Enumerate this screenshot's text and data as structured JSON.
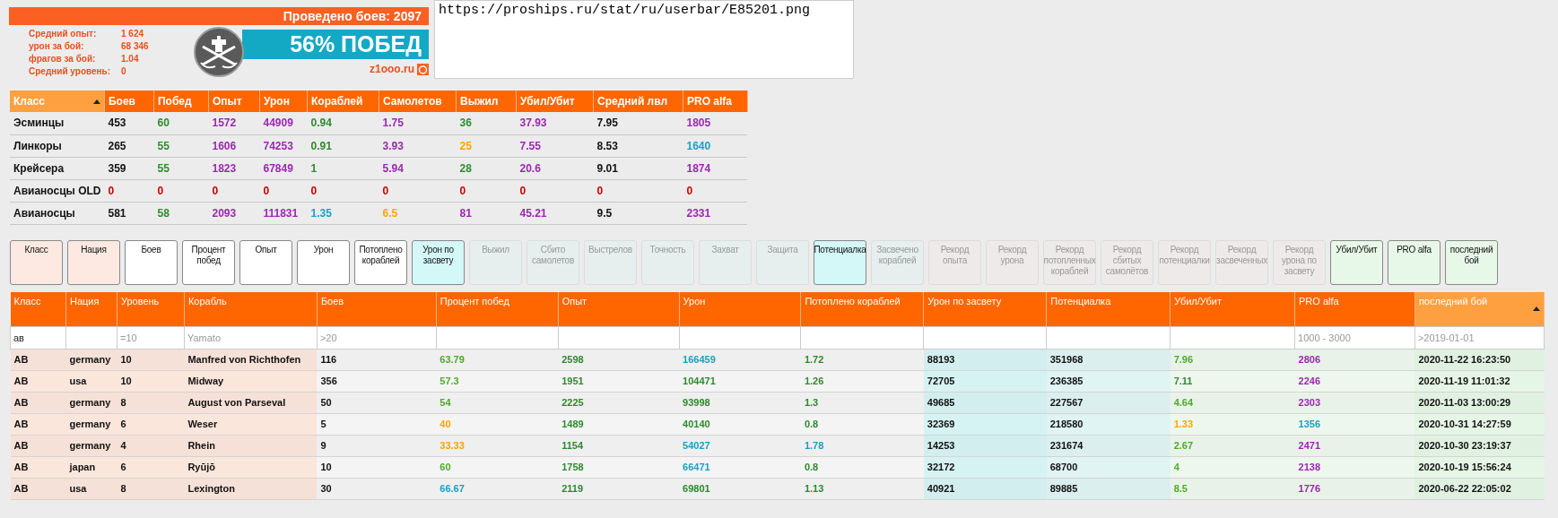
{
  "userbar": {
    "battles": "Проведено боев: 2097",
    "stats": [
      {
        "label": "Средний опыт:",
        "value": "1 624"
      },
      {
        "label": "урон за бой:",
        "value": "68 346"
      },
      {
        "label": "фрагов за бой:",
        "value": "1.04"
      },
      {
        "label": "Средний уровень:",
        "value": "0"
      }
    ],
    "winrate": "56% ПОБЕД",
    "site": "z1ooo.ru"
  },
  "link_box": {
    "value": "https://proships.ru/stat/ru/userbar/E85201.png"
  },
  "class_table": {
    "columns": [
      {
        "label": "Класс",
        "sorted": true
      },
      {
        "label": "Боев",
        "sorted": false
      },
      {
        "label": "Побед",
        "sorted": false
      },
      {
        "label": "Опыт",
        "sorted": false
      },
      {
        "label": "Урон",
        "sorted": false
      },
      {
        "label": "Кораблей",
        "sorted": false
      },
      {
        "label": "Самолетов",
        "sorted": false
      },
      {
        "label": "Выжил",
        "sorted": false
      },
      {
        "label": "Убил/Убит",
        "sorted": false
      },
      {
        "label": "Средний лвл",
        "sorted": false
      },
      {
        "label": "PRO alfa",
        "sorted": false
      }
    ],
    "rows": [
      [
        {
          "text": "Эсминцы",
          "color": "#111111"
        },
        {
          "text": "453",
          "color": "#111111"
        },
        {
          "text": "60",
          "color": "#2e8b2e"
        },
        {
          "text": "1572",
          "color": "#9c27b0"
        },
        {
          "text": "44909",
          "color": "#9c27b0"
        },
        {
          "text": "0.94",
          "color": "#2e8b2e"
        },
        {
          "text": "1.75",
          "color": "#9c27b0"
        },
        {
          "text": "36",
          "color": "#2e8b2e"
        },
        {
          "text": "37.93",
          "color": "#9c27b0"
        },
        {
          "text": "7.95",
          "color": "#111111"
        },
        {
          "text": "1805",
          "color": "#9c27b0"
        }
      ],
      [
        {
          "text": "Линкоры",
          "color": "#111111"
        },
        {
          "text": "265",
          "color": "#111111"
        },
        {
          "text": "55",
          "color": "#2e8b2e"
        },
        {
          "text": "1606",
          "color": "#9c27b0"
        },
        {
          "text": "74253",
          "color": "#9c27b0"
        },
        {
          "text": "0.91",
          "color": "#2e8b2e"
        },
        {
          "text": "3.93",
          "color": "#9c27b0"
        },
        {
          "text": "25",
          "color": "#ffa500"
        },
        {
          "text": "7.55",
          "color": "#9c27b0"
        },
        {
          "text": "8.53",
          "color": "#111111"
        },
        {
          "text": "1640",
          "color": "#1ba1c4"
        }
      ],
      [
        {
          "text": "Крейсера",
          "color": "#111111"
        },
        {
          "text": "359",
          "color": "#111111"
        },
        {
          "text": "55",
          "color": "#2e8b2e"
        },
        {
          "text": "1823",
          "color": "#9c27b0"
        },
        {
          "text": "67849",
          "color": "#9c27b0"
        },
        {
          "text": "1",
          "color": "#2e8b2e"
        },
        {
          "text": "5.94",
          "color": "#9c27b0"
        },
        {
          "text": "28",
          "color": "#2e8b2e"
        },
        {
          "text": "20.6",
          "color": "#9c27b0"
        },
        {
          "text": "9.01",
          "color": "#111111"
        },
        {
          "text": "1874",
          "color": "#9c27b0"
        }
      ],
      [
        {
          "text": "Авианосцы OLD",
          "color": "#111111"
        },
        {
          "text": "0",
          "color": "#cc0000"
        },
        {
          "text": "0",
          "color": "#cc0000"
        },
        {
          "text": "0",
          "color": "#cc0000"
        },
        {
          "text": "0",
          "color": "#cc0000"
        },
        {
          "text": "0",
          "color": "#cc0000"
        },
        {
          "text": "0",
          "color": "#cc0000"
        },
        {
          "text": "0",
          "color": "#cc0000"
        },
        {
          "text": "0",
          "color": "#cc0000"
        },
        {
          "text": "0",
          "color": "#cc0000"
        },
        {
          "text": "0",
          "color": "#cc0000"
        }
      ],
      [
        {
          "text": "Авианосцы",
          "color": "#111111"
        },
        {
          "text": "581",
          "color": "#111111"
        },
        {
          "text": "58",
          "color": "#2e8b2e"
        },
        {
          "text": "2093",
          "color": "#9c27b0"
        },
        {
          "text": "111831",
          "color": "#9c27b0"
        },
        {
          "text": "1.35",
          "color": "#1ba1c4"
        },
        {
          "text": "6.5",
          "color": "#ffa500"
        },
        {
          "text": "81",
          "color": "#9c27b0"
        },
        {
          "text": "45.21",
          "color": "#9c27b0"
        },
        {
          "text": "9.5",
          "color": "#111111"
        },
        {
          "text": "2331",
          "color": "#9c27b0"
        }
      ]
    ]
  },
  "column_toggles": [
    {
      "label": "Класс",
      "color": "#fde9e1",
      "disabled": false
    },
    {
      "label": "Нация",
      "color": "#fde9e1",
      "disabled": false
    },
    {
      "label": "Боев",
      "color": "#ffffff",
      "disabled": false
    },
    {
      "label": "Процент побед",
      "color": "#ffffff",
      "disabled": false
    },
    {
      "label": "Опыт",
      "color": "#ffffff",
      "disabled": false
    },
    {
      "label": "Урон",
      "color": "#ffffff",
      "disabled": false
    },
    {
      "label": "Потоплено кораблей",
      "color": "#ffffff",
      "disabled": false
    },
    {
      "label": "Урон по засвету",
      "color": "#d4f7f7",
      "disabled": false
    },
    {
      "label": "Выжил",
      "color": "#e6efee",
      "disabled": true
    },
    {
      "label": "Сбито самолетов",
      "color": "#e6efee",
      "disabled": true
    },
    {
      "label": "Выстрелов",
      "color": "#e6efee",
      "disabled": true
    },
    {
      "label": "Точность",
      "color": "#e6efee",
      "disabled": true
    },
    {
      "label": "Захват",
      "color": "#e6efee",
      "disabled": true
    },
    {
      "label": "Защита",
      "color": "#e6efee",
      "disabled": true
    },
    {
      "label": "Потенциалка",
      "color": "#d4f7f7",
      "disabled": false
    },
    {
      "label": "Засвечено кораблей",
      "color": "#e6efee",
      "disabled": true
    },
    {
      "label": "Рекорд опыта",
      "color": "#efeaea",
      "disabled": true
    },
    {
      "label": "Рекорд урона",
      "color": "#efeaea",
      "disabled": true
    },
    {
      "label": "Рекорд потопленных кораблей",
      "color": "#efeaea",
      "disabled": true
    },
    {
      "label": "Рекорд сбитых самолётов",
      "color": "#efeaea",
      "disabled": true
    },
    {
      "label": "Рекорд потенциалки",
      "color": "#efeaea",
      "disabled": true
    },
    {
      "label": "Рекорд засвеченных",
      "color": "#efeaea",
      "disabled": true
    },
    {
      "label": "Рекорд урона по засвету",
      "color": "#efeaea",
      "disabled": true
    },
    {
      "label": "Убил/Убит",
      "color": "#e8f8e8",
      "disabled": false
    },
    {
      "label": "PRO alfa",
      "color": "#e8f8e8",
      "disabled": false
    },
    {
      "label": "последний бой",
      "color": "#e8f8e8",
      "disabled": false
    }
  ],
  "ships_table": {
    "columns": [
      {
        "label": "Класс",
        "sorted": false,
        "color": "#fbe6dc",
        "filter": {
          "value": "ав"
        }
      },
      {
        "label": "Нация",
        "sorted": false,
        "color": "#fbe6dc"
      },
      {
        "label": "Уровень",
        "sorted": false,
        "color": "#fbe6dc",
        "filter": {
          "placeholder": "=10"
        }
      },
      {
        "label": "Корабль",
        "sorted": false,
        "color": "#fbe6dc",
        "filter": {
          "placeholder": "Yamato"
        }
      },
      {
        "label": "Боев",
        "sorted": false,
        "color": "#f4f4f4",
        "filter": {
          "placeholder": ">20"
        }
      },
      {
        "label": "Процент побед",
        "sorted": false,
        "color": "#f4f4f4"
      },
      {
        "label": "Опыт",
        "sorted": false,
        "color": "#f4f4f4"
      },
      {
        "label": "Урон",
        "sorted": false,
        "color": "#f4f4f4"
      },
      {
        "label": "Потоплено кораблей",
        "sorted": false,
        "color": "#f4f4f4"
      },
      {
        "label": "Урон по засвету",
        "sorted": false,
        "color": "#d6f3f3"
      },
      {
        "label": "Потенциалка",
        "sorted": false,
        "color": "#e0f4f4"
      },
      {
        "label": "Убил/Убит",
        "sorted": false,
        "color": "#eef7ee"
      },
      {
        "label": "PRO alfa",
        "sorted": false,
        "color": "#eef7ee",
        "filter": {
          "placeholder": "1000 - 3000"
        }
      },
      {
        "label": "последний бой",
        "sorted": true,
        "color": "#e6f6e6",
        "filter": {
          "placeholder": ">2019-01-01"
        }
      }
    ],
    "rows": [
      [
        {
          "text": "АВ",
          "color": "#111111"
        },
        {
          "text": "germany",
          "color": "#111111"
        },
        {
          "text": "10",
          "color": "#111111"
        },
        {
          "text": "Manfred von Richthofen",
          "color": "#111111"
        },
        {
          "text": "116",
          "color": "#111111"
        },
        {
          "text": "63.79",
          "color": "#4caf28"
        },
        {
          "text": "2598",
          "color": "#2e8b2e"
        },
        {
          "text": "166459",
          "color": "#1ba1c4"
        },
        {
          "text": "1.72",
          "color": "#2e8b2e"
        },
        {
          "text": "88193",
          "color": "#111111"
        },
        {
          "text": "351968",
          "color": "#111111"
        },
        {
          "text": "7.96",
          "color": "#4caf28"
        },
        {
          "text": "2806",
          "color": "#9c27b0"
        },
        {
          "text": "2020-11-22 16:23:50",
          "color": "#111111"
        }
      ],
      [
        {
          "text": "АВ",
          "color": "#111111"
        },
        {
          "text": "usa",
          "color": "#111111"
        },
        {
          "text": "10",
          "color": "#111111"
        },
        {
          "text": "Midway",
          "color": "#111111"
        },
        {
          "text": "356",
          "color": "#111111"
        },
        {
          "text": "57.3",
          "color": "#4caf28"
        },
        {
          "text": "1951",
          "color": "#2e8b2e"
        },
        {
          "text": "104471",
          "color": "#2e8b2e"
        },
        {
          "text": "1.26",
          "color": "#2e8b2e"
        },
        {
          "text": "72705",
          "color": "#111111"
        },
        {
          "text": "236385",
          "color": "#111111"
        },
        {
          "text": "7.11",
          "color": "#2e8b2e"
        },
        {
          "text": "2246",
          "color": "#9c27b0"
        },
        {
          "text": "2020-11-19 11:01:32",
          "color": "#111111"
        }
      ],
      [
        {
          "text": "АВ",
          "color": "#111111"
        },
        {
          "text": "germany",
          "color": "#111111"
        },
        {
          "text": "8",
          "color": "#111111"
        },
        {
          "text": "August von Parseval",
          "color": "#111111"
        },
        {
          "text": "50",
          "color": "#111111"
        },
        {
          "text": "54",
          "color": "#4caf28"
        },
        {
          "text": "2225",
          "color": "#2e8b2e"
        },
        {
          "text": "93998",
          "color": "#2e8b2e"
        },
        {
          "text": "1.3",
          "color": "#2e8b2e"
        },
        {
          "text": "49685",
          "color": "#111111"
        },
        {
          "text": "227567",
          "color": "#111111"
        },
        {
          "text": "4.64",
          "color": "#4caf28"
        },
        {
          "text": "2303",
          "color": "#9c27b0"
        },
        {
          "text": "2020-11-03 13:00:29",
          "color": "#111111"
        }
      ],
      [
        {
          "text": "АВ",
          "color": "#111111"
        },
        {
          "text": "germany",
          "color": "#111111"
        },
        {
          "text": "6",
          "color": "#111111"
        },
        {
          "text": "Weser",
          "color": "#111111"
        },
        {
          "text": "5",
          "color": "#111111"
        },
        {
          "text": "40",
          "color": "#ffa500"
        },
        {
          "text": "1489",
          "color": "#2e8b2e"
        },
        {
          "text": "40140",
          "color": "#2e8b2e"
        },
        {
          "text": "0.8",
          "color": "#2e8b2e"
        },
        {
          "text": "32369",
          "color": "#111111"
        },
        {
          "text": "218580",
          "color": "#111111"
        },
        {
          "text": "1.33",
          "color": "#ffa500"
        },
        {
          "text": "1356",
          "color": "#1ba1c4"
        },
        {
          "text": "2020-10-31 14:27:59",
          "color": "#111111"
        }
      ],
      [
        {
          "text": "АВ",
          "color": "#111111"
        },
        {
          "text": "germany",
          "color": "#111111"
        },
        {
          "text": "4",
          "color": "#111111"
        },
        {
          "text": "Rhein",
          "color": "#111111"
        },
        {
          "text": "9",
          "color": "#111111"
        },
        {
          "text": "33.33",
          "color": "#ffa500"
        },
        {
          "text": "1154",
          "color": "#2e8b2e"
        },
        {
          "text": "54027",
          "color": "#1ba1c4"
        },
        {
          "text": "1.78",
          "color": "#1ba1c4"
        },
        {
          "text": "14253",
          "color": "#111111"
        },
        {
          "text": "231674",
          "color": "#111111"
        },
        {
          "text": "2.67",
          "color": "#4caf28"
        },
        {
          "text": "2471",
          "color": "#9c27b0"
        },
        {
          "text": "2020-10-30 23:19:37",
          "color": "#111111"
        }
      ],
      [
        {
          "text": "АВ",
          "color": "#111111"
        },
        {
          "text": "japan",
          "color": "#111111"
        },
        {
          "text": "6",
          "color": "#111111"
        },
        {
          "text": "Ryūjō",
          "color": "#111111"
        },
        {
          "text": "10",
          "color": "#111111"
        },
        {
          "text": "60",
          "color": "#4caf28"
        },
        {
          "text": "1758",
          "color": "#2e8b2e"
        },
        {
          "text": "66471",
          "color": "#1ba1c4"
        },
        {
          "text": "0.8",
          "color": "#2e8b2e"
        },
        {
          "text": "32172",
          "color": "#111111"
        },
        {
          "text": "68700",
          "color": "#111111"
        },
        {
          "text": "4",
          "color": "#4caf28"
        },
        {
          "text": "2138",
          "color": "#9c27b0"
        },
        {
          "text": "2020-10-19 15:56:24",
          "color": "#111111"
        }
      ],
      [
        {
          "text": "АВ",
          "color": "#111111"
        },
        {
          "text": "usa",
          "color": "#111111"
        },
        {
          "text": "8",
          "color": "#111111"
        },
        {
          "text": "Lexington",
          "color": "#111111"
        },
        {
          "text": "30",
          "color": "#111111"
        },
        {
          "text": "66.67",
          "color": "#1ba1c4"
        },
        {
          "text": "2119",
          "color": "#2e8b2e"
        },
        {
          "text": "69801",
          "color": "#2e8b2e"
        },
        {
          "text": "1.13",
          "color": "#2e8b2e"
        },
        {
          "text": "40921",
          "color": "#111111"
        },
        {
          "text": "89885",
          "color": "#111111"
        },
        {
          "text": "8.5",
          "color": "#4caf28"
        },
        {
          "text": "1776",
          "color": "#9c27b0"
        },
        {
          "text": "2020-06-22 22:05:02",
          "color": "#111111"
        }
      ]
    ]
  }
}
